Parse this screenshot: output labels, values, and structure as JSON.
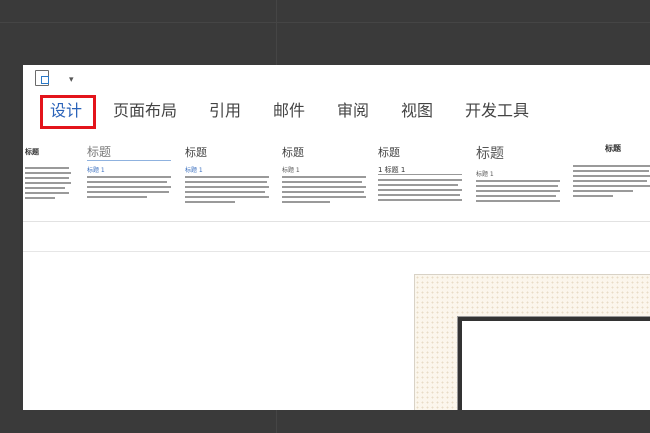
{
  "tabs": [
    {
      "label": "设计",
      "active": true
    },
    {
      "label": "页面布局"
    },
    {
      "label": "引用"
    },
    {
      "label": "邮件"
    },
    {
      "label": "审阅"
    },
    {
      "label": "视图"
    },
    {
      "label": "开发工具"
    }
  ],
  "styles_gallery": [
    {
      "title": "标题"
    },
    {
      "title": "标题",
      "subtitle": "标题 1"
    },
    {
      "title": "标题",
      "subtitle": "标题 1"
    },
    {
      "title": "标题",
      "subtitle": "标题 1"
    },
    {
      "title": "标题",
      "subtitle": "1 标题 1"
    },
    {
      "title": "标题",
      "subtitle": "标题 1"
    },
    {
      "title": "标题"
    }
  ],
  "colors": {
    "highlight": "#e3141b",
    "active_tab": "#2b63b9"
  },
  "icons": {
    "save": "save-icon",
    "qat_dropdown": "chevron-down-icon"
  }
}
